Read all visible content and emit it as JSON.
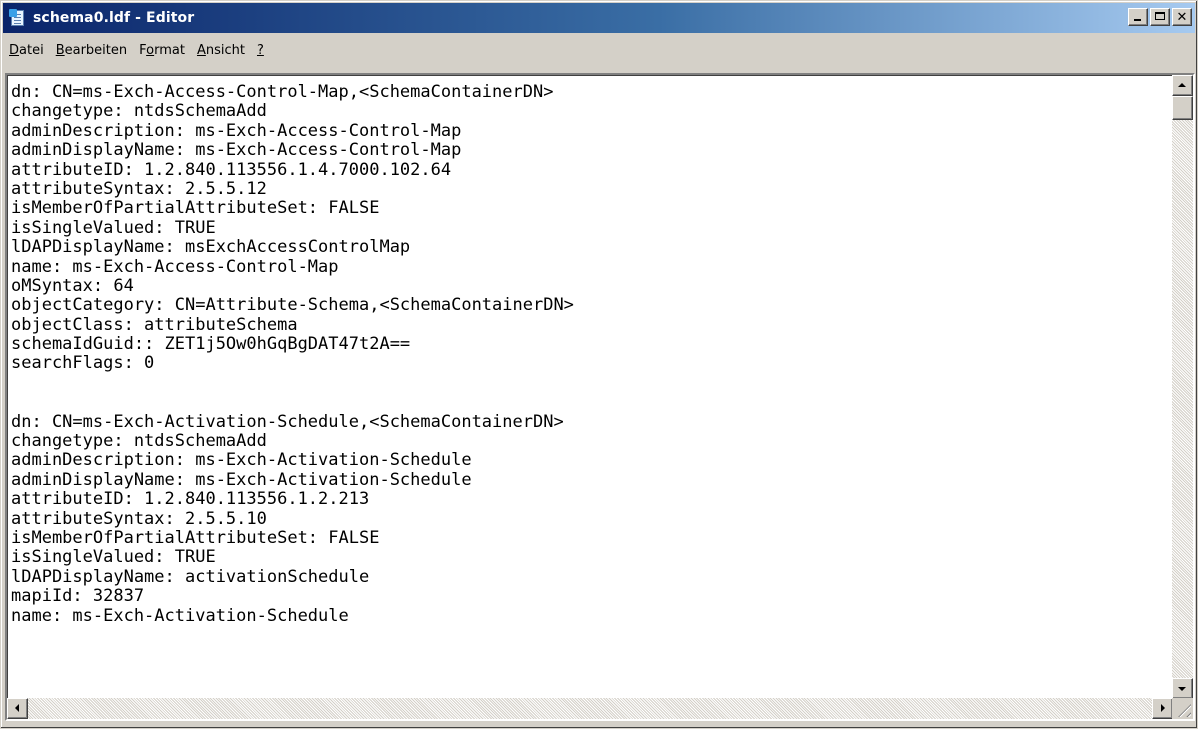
{
  "window": {
    "title": "schema0.ldf - Editor"
  },
  "menu": [
    {
      "accel": "D",
      "rest": "atei"
    },
    {
      "accel": "B",
      "rest": "earbeiten"
    },
    {
      "pre": "F",
      "accel": "o",
      "rest": "rmat"
    },
    {
      "accel": "A",
      "rest": "nsicht"
    },
    {
      "accel": "?",
      "rest": ""
    }
  ],
  "editor": {
    "lines": [
      "dn: CN=ms-Exch-Access-Control-Map,<SchemaContainerDN>",
      "changetype: ntdsSchemaAdd",
      "adminDescription: ms-Exch-Access-Control-Map",
      "adminDisplayName: ms-Exch-Access-Control-Map",
      "attributeID: 1.2.840.113556.1.4.7000.102.64",
      "attributeSyntax: 2.5.5.12",
      "isMemberOfPartialAttributeSet: FALSE",
      "isSingleValued: TRUE",
      "lDAPDisplayName: msExchAccessControlMap",
      "name: ms-Exch-Access-Control-Map",
      "oMSyntax: 64",
      "objectCategory: CN=Attribute-Schema,<SchemaContainerDN>",
      "objectClass: attributeSchema",
      "schemaIdGuid:: ZET1j5Ow0hGqBgDAT47t2A==",
      "searchFlags: 0",
      "",
      "",
      "dn: CN=ms-Exch-Activation-Schedule,<SchemaContainerDN>",
      "changetype: ntdsSchemaAdd",
      "adminDescription: ms-Exch-Activation-Schedule",
      "adminDisplayName: ms-Exch-Activation-Schedule",
      "attributeID: 1.2.840.113556.1.2.213",
      "attributeSyntax: 2.5.5.10",
      "isMemberOfPartialAttributeSet: FALSE",
      "isSingleValued: TRUE",
      "lDAPDisplayName: activationSchedule",
      "mapiId: 32837",
      "name: ms-Exch-Activation-Schedule"
    ]
  },
  "icons": {
    "app": "notepad-icon",
    "minimize": "minimize-icon",
    "maximize": "maximize-icon",
    "close": "close-icon"
  },
  "colors": {
    "titlebar_start": "#0a246a",
    "titlebar_end": "#a6caf0",
    "chrome": "#d4d0c8"
  }
}
